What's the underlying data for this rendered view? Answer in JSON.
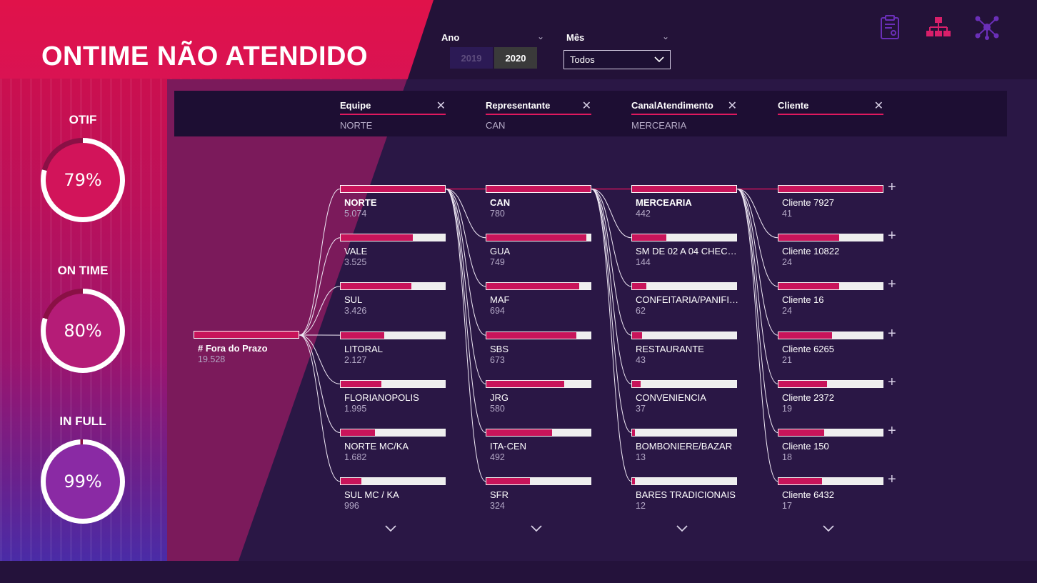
{
  "title": "ONTIME NÃO ATENDIDO",
  "kpis": [
    {
      "label": "OTIF",
      "value": "79%",
      "fraction": 0.79
    },
    {
      "label": "ON TIME",
      "value": "80%",
      "fraction": 0.8
    },
    {
      "label": "IN FULL",
      "value": "99%",
      "fraction": 0.99
    }
  ],
  "filters": {
    "year_label": "Ano",
    "years": [
      "2019",
      "2020"
    ],
    "selected_year": "2020",
    "month_label": "Mês",
    "month_value": "Todos"
  },
  "levels": [
    {
      "title": "Equipe",
      "value": "NORTE"
    },
    {
      "title": "Representante",
      "value": "CAN"
    },
    {
      "title": "CanalAtendimento",
      "value": "MERCEARIA"
    },
    {
      "title": "Cliente",
      "value": ""
    }
  ],
  "root": {
    "label": "# Fora do Prazo",
    "value": "19.528"
  },
  "columns": [
    {
      "items": [
        {
          "label": "NORTE",
          "value": "5.074",
          "fill": 1.0,
          "selected": true
        },
        {
          "label": "VALE",
          "value": "3.525",
          "fill": 0.695
        },
        {
          "label": "SUL",
          "value": "3.426",
          "fill": 0.675
        },
        {
          "label": "LITORAL",
          "value": "2.127",
          "fill": 0.419
        },
        {
          "label": "FLORIANOPOLIS",
          "value": "1.995",
          "fill": 0.393
        },
        {
          "label": "NORTE MC/KA",
          "value": "1.682",
          "fill": 0.331
        },
        {
          "label": "SUL MC / KA",
          "value": "996",
          "fill": 0.196
        }
      ]
    },
    {
      "items": [
        {
          "label": "CAN",
          "value": "780",
          "fill": 1.0,
          "selected": true
        },
        {
          "label": "GUA",
          "value": "749",
          "fill": 0.96
        },
        {
          "label": "MAF",
          "value": "694",
          "fill": 0.89
        },
        {
          "label": "SBS",
          "value": "673",
          "fill": 0.863
        },
        {
          "label": "JRG",
          "value": "580",
          "fill": 0.744
        },
        {
          "label": "ITA-CEN",
          "value": "492",
          "fill": 0.631
        },
        {
          "label": "SFR",
          "value": "324",
          "fill": 0.415
        }
      ]
    },
    {
      "items": [
        {
          "label": "MERCEARIA",
          "value": "442",
          "fill": 1.0,
          "selected": true
        },
        {
          "label": "SM DE 02 A 04 CHECK...",
          "value": "144",
          "fill": 0.326
        },
        {
          "label": "CONFEITARIA/PANIFIC...",
          "value": "62",
          "fill": 0.14
        },
        {
          "label": "RESTAURANTE",
          "value": "43",
          "fill": 0.097
        },
        {
          "label": "CONVENIENCIA",
          "value": "37",
          "fill": 0.084
        },
        {
          "label": "BOMBONIERE/BAZAR",
          "value": "13",
          "fill": 0.029
        },
        {
          "label": "BARES TRADICIONAIS",
          "value": "12",
          "fill": 0.027
        }
      ]
    },
    {
      "items": [
        {
          "label": "Cliente 7927",
          "value": "41",
          "fill": 1.0
        },
        {
          "label": "Cliente 10822",
          "value": "24",
          "fill": 0.585
        },
        {
          "label": "Cliente 16",
          "value": "24",
          "fill": 0.585
        },
        {
          "label": "Cliente 6265",
          "value": "21",
          "fill": 0.512
        },
        {
          "label": "Cliente 2372",
          "value": "19",
          "fill": 0.463
        },
        {
          "label": "Cliente 150",
          "value": "18",
          "fill": 0.439
        },
        {
          "label": "Cliente 6432",
          "value": "17",
          "fill": 0.415
        }
      ]
    }
  ],
  "colors": {
    "accent": "#c8145a",
    "panel": "#2a1745",
    "header": "#1d0e33",
    "icon_purple": "#6a2fb8",
    "icon_pink": "#d81f6a"
  },
  "icons": [
    "report-clipboard-icon",
    "hierarchy-icon",
    "network-icon"
  ]
}
